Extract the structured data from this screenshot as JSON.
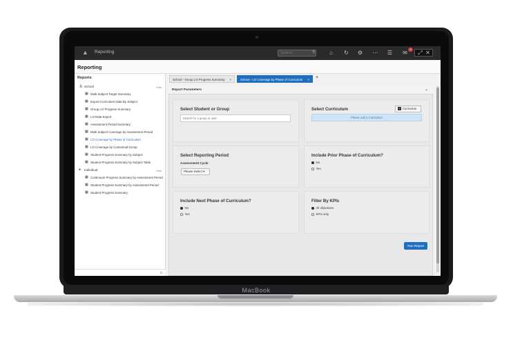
{
  "device": {
    "brand": "MacBook"
  },
  "topbar": {
    "app_title": "Reporting",
    "search_placeholder": "Search",
    "notification_count": "9"
  },
  "page": {
    "heading": "Reporting"
  },
  "sidebar": {
    "title": "Reports",
    "groups": [
      {
        "label": "School",
        "hide_label": "Hide",
        "icon": "building-icon"
      },
      {
        "label": "Individual",
        "hide_label": "Hide",
        "icon": "person-icon"
      }
    ],
    "school_items": [
      "Multi Subject Target Summary",
      "Export Curriculum Data By Subject",
      "Group LO Progress Summary",
      "LO Data Export",
      "Assessment Period Summary",
      "Multi Subject Coverage by Assessment Period",
      "LO Coverage by Phase of Curriculum",
      "LO Coverage by Contextual Group",
      "Student Progress Summary by Subject",
      "Student Progress Summary by Subject Table"
    ],
    "individual_items": [
      "Continuum Progress Summary by Assessment Period",
      "Student Progress Summary by Assessment Period",
      "Student Progress Summary"
    ]
  },
  "tabs": [
    {
      "label": "School - Group LO Progress Summary",
      "close": "×"
    },
    {
      "label": "School - LO Coverage by Phase of Curriculum",
      "close": "×"
    }
  ],
  "tab_add": "+",
  "panel": {
    "title": "Report Parameters",
    "select_student": {
      "title": "Select Student or Group",
      "placeholder": "Search for a group or user"
    },
    "select_curriculum": {
      "title": "Select Curriculum",
      "button": "Curriculum",
      "empty": "Please add a Curriculum"
    },
    "reporting_period": {
      "title": "Select Reporting Period",
      "label": "Assessment Cycle",
      "select": "Please Select ▾"
    },
    "prior_phase": {
      "title": "Include Prior Phase of Curriculum?",
      "options": [
        "No",
        "Yes"
      ]
    },
    "next_phase": {
      "title": "Include Next Phase of Curriculum?",
      "options": [
        "No",
        "Yes"
      ]
    },
    "filter_kpis": {
      "title": "Filter By KPIs",
      "options": [
        "All objectives",
        "KPIs only"
      ]
    },
    "run_button": "Run Report"
  },
  "colors": {
    "accent": "#1f6fc0",
    "topbar": "#2a2a2a",
    "badge": "#d63a3a"
  }
}
